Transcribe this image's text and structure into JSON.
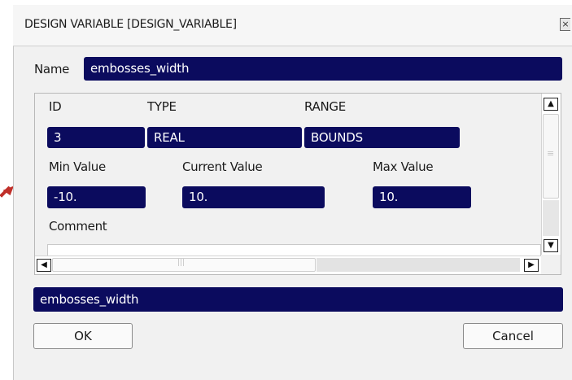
{
  "dialog": {
    "title": "DESIGN VARIABLE [DESIGN_VARIABLE]",
    "close_glyph": "×"
  },
  "name_row": {
    "label": "Name",
    "value": "embosses_width"
  },
  "properties": {
    "id_header": "ID",
    "type_header": "TYPE",
    "range_header": "RANGE",
    "id_value": "3",
    "type_value": "REAL",
    "range_value": "BOUNDS",
    "min_label": "Min Value",
    "current_label": "Current Value",
    "max_label": "Max Value",
    "min_value": "-10.",
    "current_value": "10.",
    "max_value": "10.",
    "comment_label": "Comment"
  },
  "scrollbar": {
    "up_icon": "▲",
    "down_icon": "▼",
    "left_icon": "◀",
    "right_icon": "▶",
    "grip_vertical": "≡",
    "grip_horizontal": "|||"
  },
  "bottom_field": {
    "value": "embosses_width"
  },
  "buttons": {
    "ok_label": "OK",
    "cancel_label": "Cancel"
  },
  "colors": {
    "field_background": "#0b0b5e",
    "field_text": "#ffffff",
    "dialog_background": "#f1f1f1",
    "annotation_arrow": "#c0302a"
  }
}
